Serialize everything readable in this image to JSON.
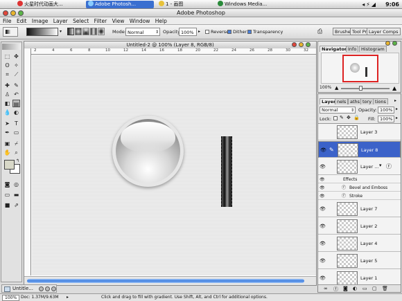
{
  "taskbar": {
    "apps": [
      "火星时代动画大...",
      "Adobe Photosh...",
      "1 - 画图",
      "Windows Media..."
    ],
    "clock": "9:06"
  },
  "window": {
    "title": "Adobe Photoshop"
  },
  "menu": [
    "File",
    "Edit",
    "Image",
    "Layer",
    "Select",
    "Filter",
    "View",
    "Window",
    "Help"
  ],
  "options": {
    "mode_label": "Mode:",
    "mode_value": "Normal",
    "opacity_label": "Opacity:",
    "opacity_value": "100%",
    "reverse_label": "Reverse",
    "reverse_checked": false,
    "dither_label": "Dither",
    "dither_checked": true,
    "transparency_label": "Transparency",
    "transparency_checked": true,
    "palette_tabs": [
      "Brushes",
      "Tool Pr",
      "Layer Comps"
    ]
  },
  "document": {
    "title": "Untitled-2 @ 100% (Layer 8, RGB/8)",
    "ruler_ticks": [
      "2",
      "4",
      "6",
      "8",
      "10",
      "12",
      "14",
      "16",
      "18",
      "20",
      "22",
      "24",
      "26",
      "28",
      "30",
      "32"
    ]
  },
  "status": {
    "zoom": "100%",
    "doc_info": "Doc: 1.37M/9.63M",
    "hint": "Click and drag to fill with gradient. Use Shift, Alt, and Ctrl for additional options."
  },
  "minimized_doc": {
    "label": "Untitle..."
  },
  "navigator": {
    "tabs": [
      "Navigator",
      "Info",
      "Histogram"
    ],
    "zoom": "100%"
  },
  "layers_panel": {
    "tabs": [
      "Layers",
      "nels",
      "aths",
      "tory",
      "tions"
    ],
    "blend_mode": "Normal",
    "opacity_label": "Opacity:",
    "opacity_value": "100%",
    "lock_label": "Lock:",
    "fill_label": "Fill:",
    "fill_value": "100%",
    "layers": [
      {
        "name": "Layer 3",
        "visible": false,
        "selected": false
      },
      {
        "name": "Layer 8",
        "visible": true,
        "selected": true
      },
      {
        "name": "Layer ...",
        "visible": true,
        "selected": false
      }
    ],
    "effects_label": "Effects",
    "effects": [
      "Bevel and Emboss",
      "Stroke"
    ],
    "layers_below": [
      {
        "name": "Layer 7",
        "visible": true
      },
      {
        "name": "Layer 2",
        "visible": true
      },
      {
        "name": "Layer 4",
        "visible": true
      },
      {
        "name": "Layer 5",
        "visible": true
      },
      {
        "name": "Layer 1",
        "visible": true
      }
    ]
  },
  "colors": {
    "selection_blue": "#3b62c9",
    "scrollbar_blue": "#4a86e8"
  }
}
